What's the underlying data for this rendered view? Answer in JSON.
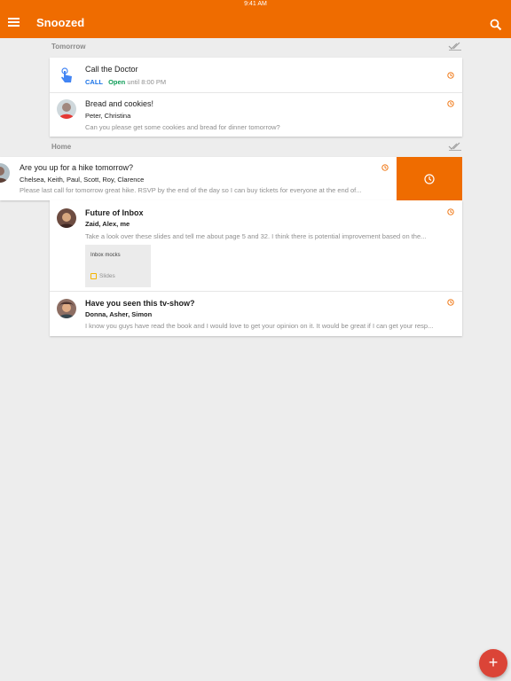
{
  "status_bar": {
    "time": "9:41 AM"
  },
  "app_bar": {
    "title": "Snoozed"
  },
  "sections": [
    {
      "label": "Tomorrow"
    },
    {
      "label": "Home"
    }
  ],
  "reminder": {
    "title": "Call the Doctor",
    "action_label": "CALL",
    "open_label": "Open",
    "hours_label": "until 8:00 PM"
  },
  "threads": [
    {
      "subject": "Bread and cookies!",
      "participants": "Peter, Christina",
      "snippet": "Can you please get some cookies and bread for dinner tomorrow?"
    },
    {
      "subject": "Are you up for a hike tomorrow?",
      "participants": "Chelsea, Keith, Paul, Scott, Roy, Clarence",
      "snippet": "Please last call for tomorrow great hike. RSVP by the end of the day so I can buy tickets for everyone at the end of..."
    },
    {
      "subject": "Future of Inbox",
      "participants": "Zaid, Alex, me",
      "snippet": "Take a look over these slides and tell me about page 5 and 32. I think there is potential improvement based on the...",
      "attachment": {
        "title": "Inbox mocks",
        "type": "Slides"
      }
    },
    {
      "subject": "Have you seen this tv-show?",
      "participants": "Donna, Asher, Simon",
      "snippet": "I know you guys have read the book and I would love to get your opinion on it. It would be great if I can get your resp..."
    }
  ],
  "fab": {
    "glyph": "+"
  },
  "colors": {
    "accent": "#ef6c00",
    "fab": "#db4437",
    "call": "#1a73e8",
    "open": "#0f9d58"
  },
  "icons": [
    "menu-icon",
    "search-icon",
    "done-all-icon",
    "snooze-clock-icon",
    "touch-hand-icon",
    "slides-icon",
    "plus-icon"
  ]
}
